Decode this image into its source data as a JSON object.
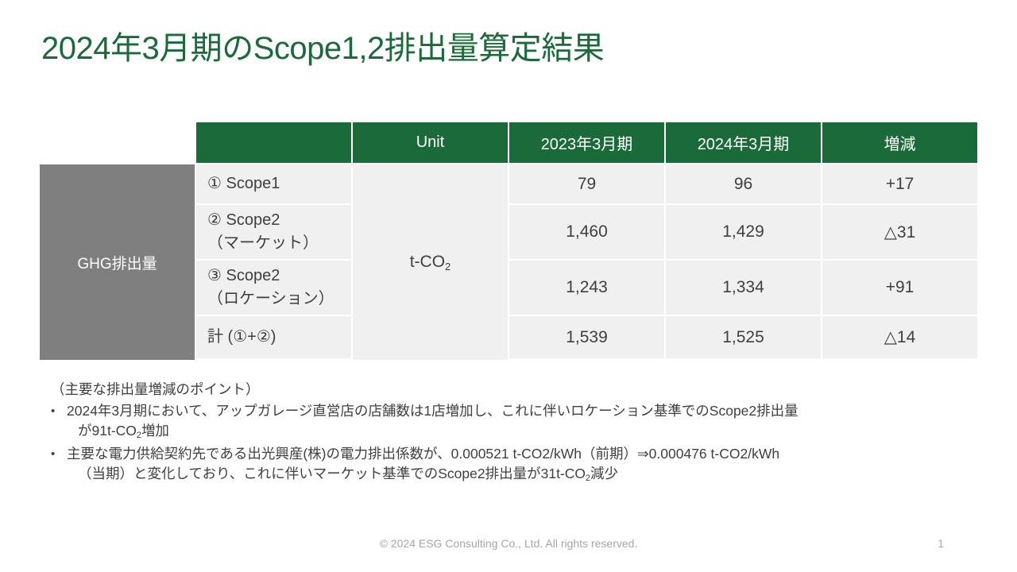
{
  "slide": {
    "title": "2024年3月期のScope1,2排出量算定結果",
    "title_color": "#1a6b39",
    "header_bg": "#1a6b39",
    "rowlabel_bg": "#7f7f7f",
    "cell_bg": "#f0f0f0"
  },
  "table": {
    "headers": {
      "blank": "",
      "unit": "Unit",
      "fy2023": "2023年3月期",
      "fy2024": "2024年3月期",
      "change": "増減"
    },
    "group_label": "GHG排出量",
    "unit_value_prefix": "t-CO",
    "unit_value_sub": "2",
    "rows": [
      {
        "item_line1": "① Scope1",
        "item_line2": "",
        "fy2023": "79",
        "fy2024": "96",
        "change": "+17"
      },
      {
        "item_line1": "② Scope2",
        "item_line2": "（マーケット）",
        "fy2023": "1,460",
        "fy2024": "1,429",
        "change": "△31"
      },
      {
        "item_line1": "③ Scope2",
        "item_line2": "（ロケーション）",
        "fy2023": "1,243",
        "fy2024": "1,334",
        "change": "+91"
      },
      {
        "item_line1": "計 (①+②)",
        "item_line2": "",
        "fy2023": "1,539",
        "fy2024": "1,525",
        "change": "△14"
      }
    ]
  },
  "notes": {
    "heading": "（主要な排出量増減のポイント）",
    "bullet_marker": "•",
    "bullet1_line1": "2024年3月期において、アップガレージ直営店の店舗数は1店増加し、これに伴いロケーション基準でのScope2排出量",
    "bullet1_line2_pre": "が91t-CO",
    "bullet1_line2_sub": "2",
    "bullet1_line2_post": "増加",
    "bullet2_line1": "主要な電力供給契約先である出光興産(株)の電力排出係数が、0.000521 t-CO2/kWh（前期）⇒0.000476 t-CO2/kWh",
    "bullet2_line2_pre": "（当期）と変化しており、これに伴いマーケット基準でのScope2排出量が31t-CO",
    "bullet2_line2_sub": "2",
    "bullet2_line2_post": "減少"
  },
  "footer": {
    "copyright": "© 2024 ESG Consulting Co., Ltd. All rights reserved.",
    "page_number": "1"
  }
}
